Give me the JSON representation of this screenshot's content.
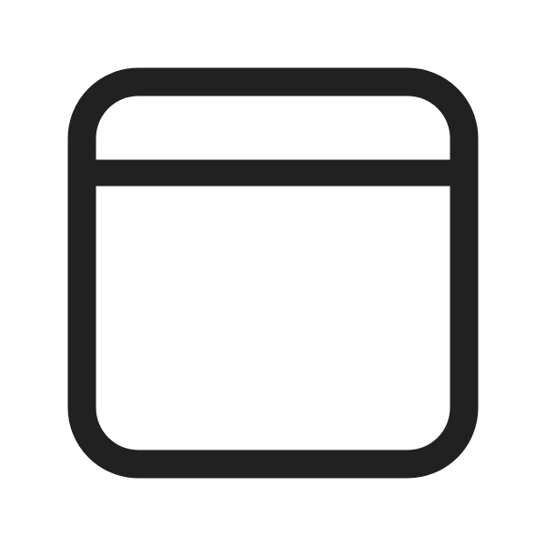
{
  "icon": {
    "name": "window-icon",
    "stroke_color": "#212121",
    "background_color": "#ffffff"
  }
}
